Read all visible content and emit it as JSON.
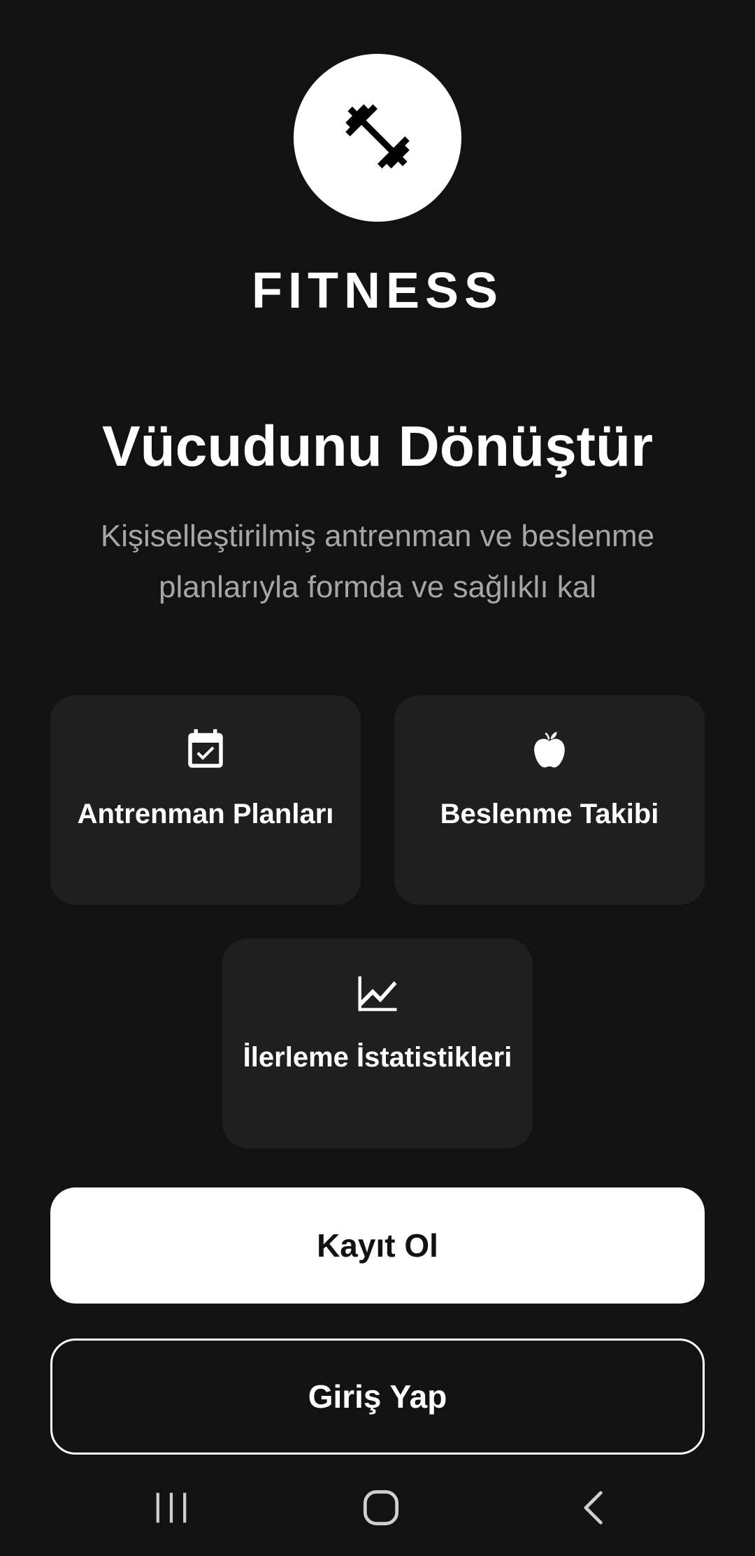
{
  "logo": {
    "icon": "dumbbell-icon",
    "brand": "FITNESS"
  },
  "hero": {
    "title": "Vücudunu Dönüştür",
    "subtitle": "Kişiselleştirilmiş antrenman ve beslenme planlarıyla formda ve sağlıklı kal"
  },
  "features": [
    {
      "icon": "calendar-check-icon",
      "label": "Antrenman Planları"
    },
    {
      "icon": "apple-icon",
      "label": "Beslenme Takibi"
    },
    {
      "icon": "trending-chart-icon",
      "label": "İlerleme İstatistikleri"
    }
  ],
  "actions": {
    "register_label": "Kayıt Ol",
    "login_label": "Giriş Yap"
  },
  "system_nav": {
    "recent_icon": "recent-apps-icon",
    "home_icon": "home-icon",
    "back_icon": "back-icon"
  },
  "colors": {
    "background": "#121212",
    "card": "#1f1f1f",
    "primary": "#ffffff",
    "muted_text": "#a6a6a6"
  }
}
